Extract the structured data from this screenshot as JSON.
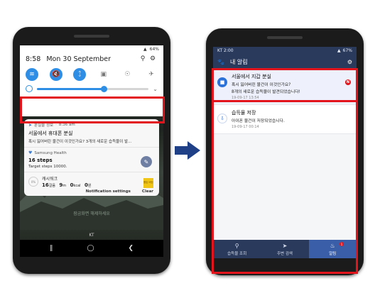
{
  "left_phone": {
    "status_bar": {
      "battery": "64%"
    },
    "shade_header": {
      "time": "8:58",
      "date": "Mon 30 September"
    },
    "quick_settings": [
      {
        "name": "wifi",
        "icon": "wifi-icon",
        "on": true
      },
      {
        "name": "mute",
        "icon": "mute-icon",
        "on": true
      },
      {
        "name": "bluetooth",
        "icon": "bluetooth-icon",
        "on": true
      },
      {
        "name": "screen",
        "icon": "screen-icon",
        "on": false
      },
      {
        "name": "flashlight",
        "icon": "flashlight-icon",
        "on": false
      },
      {
        "name": "airplane",
        "icon": "airplane-icon",
        "on": false
      }
    ],
    "brightness": 0.6,
    "lost_notification": {
      "app": "분실물 정보",
      "time": "8:36 am",
      "title": "서울에서 휴대폰 분실",
      "body": "혹시 잃어버린 물건이 이것인가요? 3개의 새로운 습득물이 발..."
    },
    "health_notification": {
      "app": "Samsung Health",
      "title": "16 steps",
      "body": "Target steps 10000."
    },
    "cashwalk": {
      "ring": "0%",
      "title": "캐시워크",
      "steps_value": "16",
      "steps_unit": "걸음",
      "minutes_value": "9",
      "minutes_unit": "m",
      "kcal_value": "0",
      "kcal_unit": "kcal",
      "points_value": "0",
      "points_unit": "원",
      "badge": "용돈 버는"
    },
    "actions": {
      "settings": "Notification settings",
      "clear": "Clear"
    },
    "lock_message": "잠금화면 해제하세요",
    "carrier": "KT"
  },
  "right_phone": {
    "status_bar": {
      "carrier_time": "KT 2:00",
      "battery": "67%"
    },
    "header": {
      "title": "내 알림"
    },
    "notifications": [
      {
        "title": "서울에서 지갑 분실",
        "line1": "혹시 잃어버린 물건이 이것인가요?",
        "line2": "8개의 새로운 습득물이 발견되었습니다!",
        "date": "19-09-17 13:54",
        "new_badge": "N"
      },
      {
        "title": "습득물 저장",
        "line1": "아이폰 물건이 저장되었습니다.",
        "date": "19-09-17 00:14"
      }
    ],
    "tabs": [
      {
        "label": "습득물 조회",
        "icon": "search-icon"
      },
      {
        "label": "주변 검색",
        "icon": "navigation-icon"
      },
      {
        "label": "알림",
        "icon": "bell-icon",
        "badge": "1"
      }
    ]
  },
  "colors": {
    "highlight": "#e3141c",
    "app_navy": "#2a3a5c",
    "accent_blue": "#2e8ee6",
    "arrow": "#1f3f86"
  }
}
